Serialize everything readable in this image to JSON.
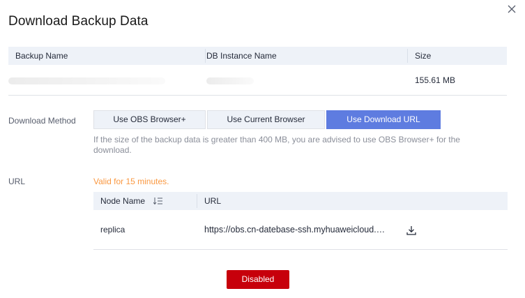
{
  "dialog": {
    "title": "Download Backup Data"
  },
  "backup_table": {
    "columns": [
      "Backup Name",
      "DB Instance Name",
      "Size"
    ],
    "rows": [
      {
        "backup_name": "",
        "db_instance_name": "",
        "size": "155.61 MB"
      }
    ]
  },
  "download_method": {
    "label": "Download Method",
    "options": [
      "Use OBS Browser+",
      "Use Current Browser",
      "Use Download URL"
    ],
    "selected": "Use Download URL",
    "hint": "If the size of the backup data is greater than 400 MB, you are advised to use OBS Browser+ for the download."
  },
  "url_section": {
    "label": "URL",
    "validity": "Valid for 15 minutes.",
    "columns": [
      "Node Name",
      "URL"
    ],
    "rows": [
      {
        "node_name": "replica",
        "url": "https://obs.cn-datebase-ssh.myhuaweicloud.com"
      }
    ]
  },
  "footer": {
    "button_label": "Disabled"
  },
  "colors": {
    "accent": "#5e7ce0",
    "warning": "#fa9841",
    "danger": "#c7000b"
  },
  "icons": {
    "close": "close-icon",
    "sort": "sort-icon",
    "download": "download-icon"
  }
}
